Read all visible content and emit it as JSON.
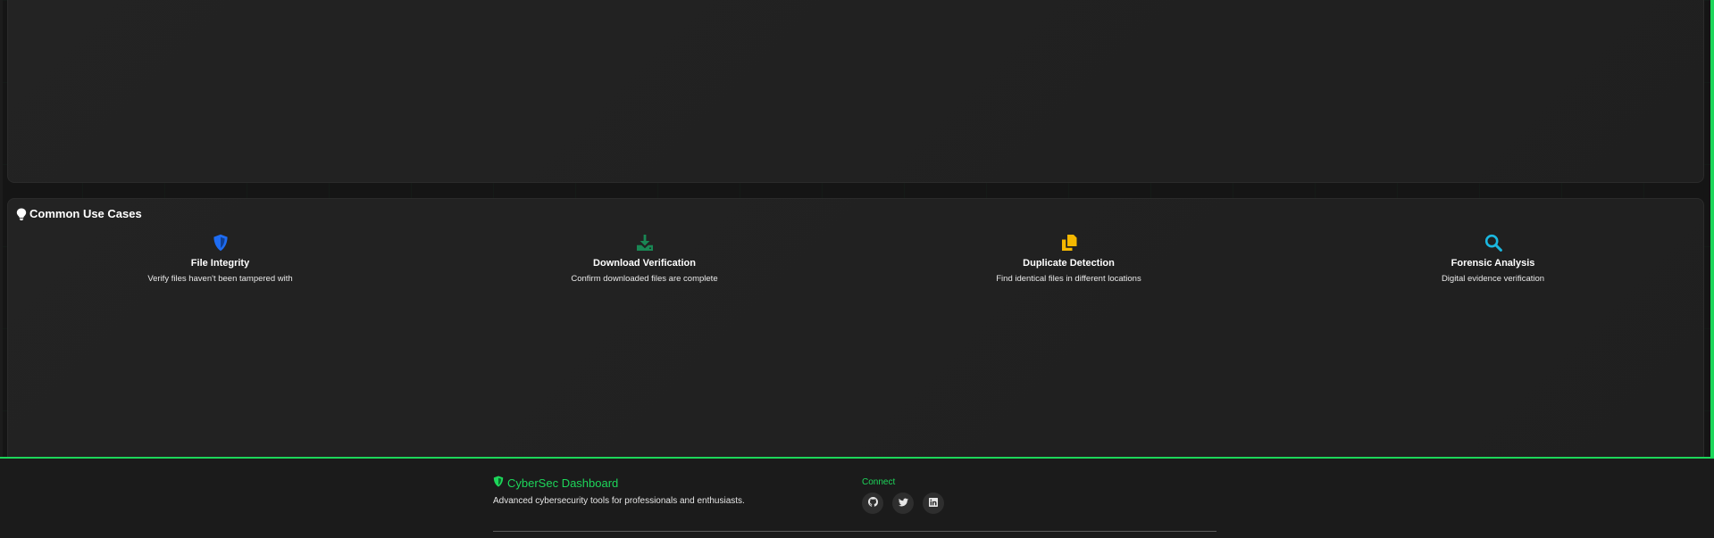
{
  "colors": {
    "accent": "#1dd65a",
    "file_integrity_icon": "#1e6cf2",
    "download_icon": "#198754",
    "duplicate_icon": "#f5b800",
    "forensic_icon": "#1bb8e0"
  },
  "use_cases": {
    "title": "Common Use Cases",
    "title_icon": "lightbulb-icon",
    "items": [
      {
        "icon": "shield-half-icon",
        "title": "File Integrity",
        "description": "Verify files haven't been tampered with"
      },
      {
        "icon": "download-icon",
        "title": "Download Verification",
        "description": "Confirm downloaded files are complete"
      },
      {
        "icon": "copy-files-icon",
        "title": "Duplicate Detection",
        "description": "Find identical files in different locations"
      },
      {
        "icon": "search-icon",
        "title": "Forensic Analysis",
        "description": "Digital evidence verification"
      }
    ]
  },
  "footer": {
    "brand": "CyberSec Dashboard",
    "brand_icon": "shield-icon",
    "tagline": "Advanced cybersecurity tools for professionals and enthusiasts.",
    "connect_heading": "Connect",
    "social": [
      "github-icon",
      "twitter-icon",
      "linkedin-icon"
    ]
  }
}
